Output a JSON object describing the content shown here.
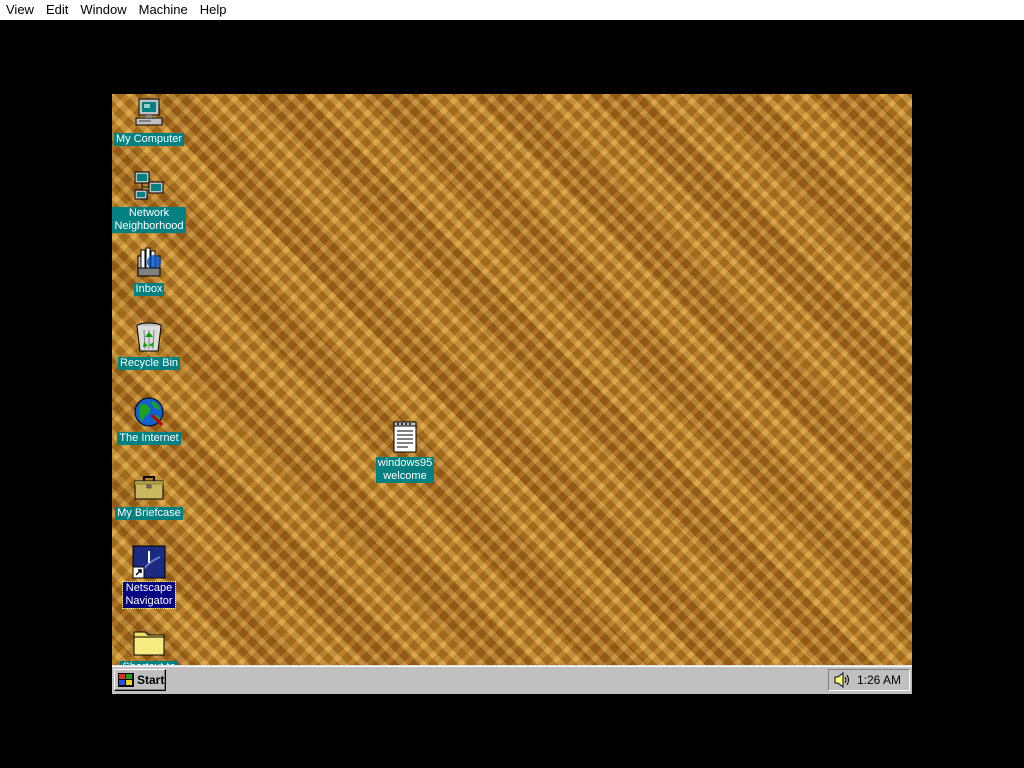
{
  "host_menu": [
    "View",
    "Edit",
    "Window",
    "Machine",
    "Help"
  ],
  "desktop": {
    "icons": [
      {
        "label": "My Computer",
        "icon": "computer-icon"
      },
      {
        "label": "Network\nNeighborhood",
        "icon": "network-icon"
      },
      {
        "label": "Inbox",
        "icon": "inbox-icon"
      },
      {
        "label": "Recycle Bin",
        "icon": "recycle-bin-icon"
      },
      {
        "label": "The Internet",
        "icon": "internet-globe-icon"
      },
      {
        "label": "My Briefcase",
        "icon": "briefcase-icon"
      },
      {
        "label": "Netscape\nNavigator",
        "icon": "netscape-icon"
      },
      {
        "label": "Shortcut to",
        "icon": "folder-icon"
      },
      {
        "label": "windows95\nwelcome",
        "icon": "text-document-icon"
      }
    ]
  },
  "taskbar": {
    "start_label": "Start",
    "clock": "1:26 AM"
  },
  "colors": {
    "icon_label_bg": "#008080",
    "selected_label_bg": "#000080",
    "taskbar_bg": "#c0c0c0"
  }
}
